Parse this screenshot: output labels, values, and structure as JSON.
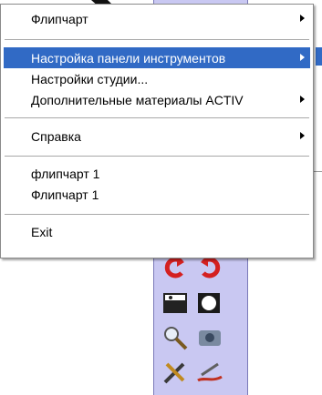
{
  "menu": {
    "items": [
      {
        "label": "Флипчарт",
        "submenu": true
      },
      {
        "label": "Настройка панели инструментов",
        "submenu": true,
        "selected": true
      },
      {
        "label": "Настройки студии...",
        "submenu": false
      },
      {
        "label": "Дополнительные материалы ACTIV",
        "submenu": true
      },
      {
        "label": "Справка",
        "submenu": true
      },
      {
        "label": "флипчарт 1",
        "submenu": false
      },
      {
        "label": "Флипчарт 1",
        "submenu": false
      },
      {
        "label": "Exit",
        "submenu": false
      }
    ]
  },
  "colors": {
    "selection": "#316ac5",
    "toolbar_bg": "#c9c8f2"
  },
  "toolbar": {
    "icons": [
      "undo-icon",
      "redo-icon",
      "camera-icon",
      "spotlight-icon",
      "magnifier-icon",
      "screen-recorder-icon",
      "tools-icon",
      "pen-icon"
    ]
  }
}
